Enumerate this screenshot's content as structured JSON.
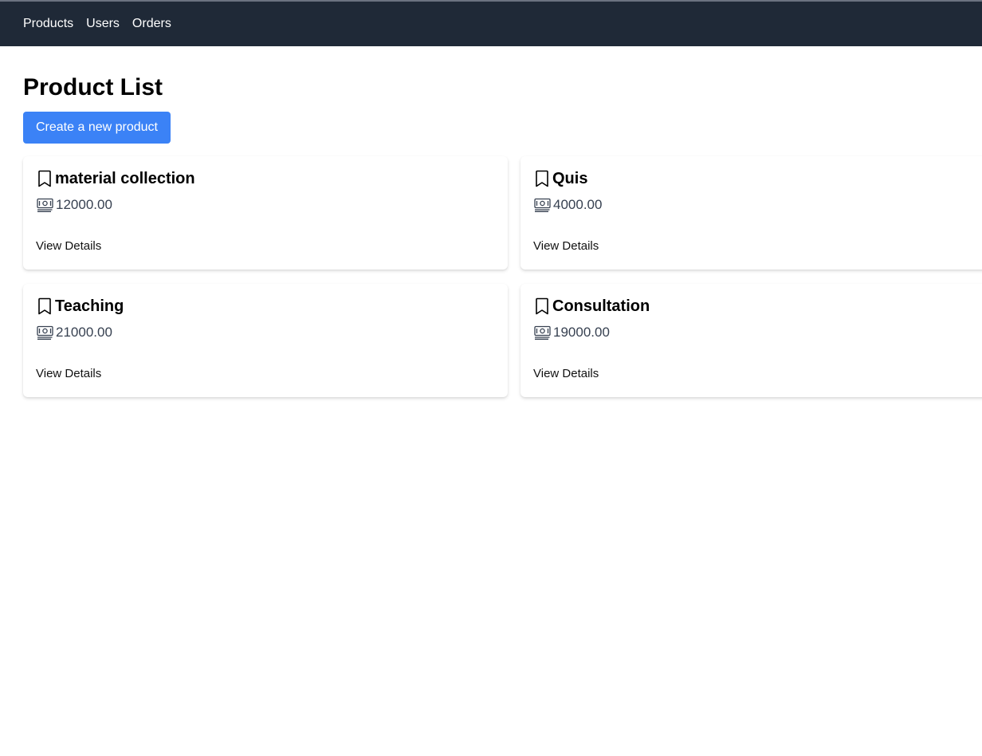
{
  "nav": {
    "items": [
      {
        "label": "Products"
      },
      {
        "label": "Users"
      },
      {
        "label": "Orders"
      }
    ]
  },
  "page": {
    "title": "Product List",
    "create_button_label": "Create a new product"
  },
  "products": [
    {
      "name": "material collection",
      "price": "12000.00",
      "link_label": "View Details"
    },
    {
      "name": "Quis",
      "price": "4000.00",
      "link_label": "View Details"
    },
    {
      "name": "Teaching",
      "price": "21000.00",
      "link_label": "View Details"
    },
    {
      "name": "Consultation",
      "price": "19000.00",
      "link_label": "View Details"
    }
  ],
  "icons": {
    "title_icon": "bookmark-icon",
    "price_icon": "banknotes-icon"
  },
  "colors": {
    "navbar_bg": "#1f2937",
    "accent": "#3b82f6"
  }
}
